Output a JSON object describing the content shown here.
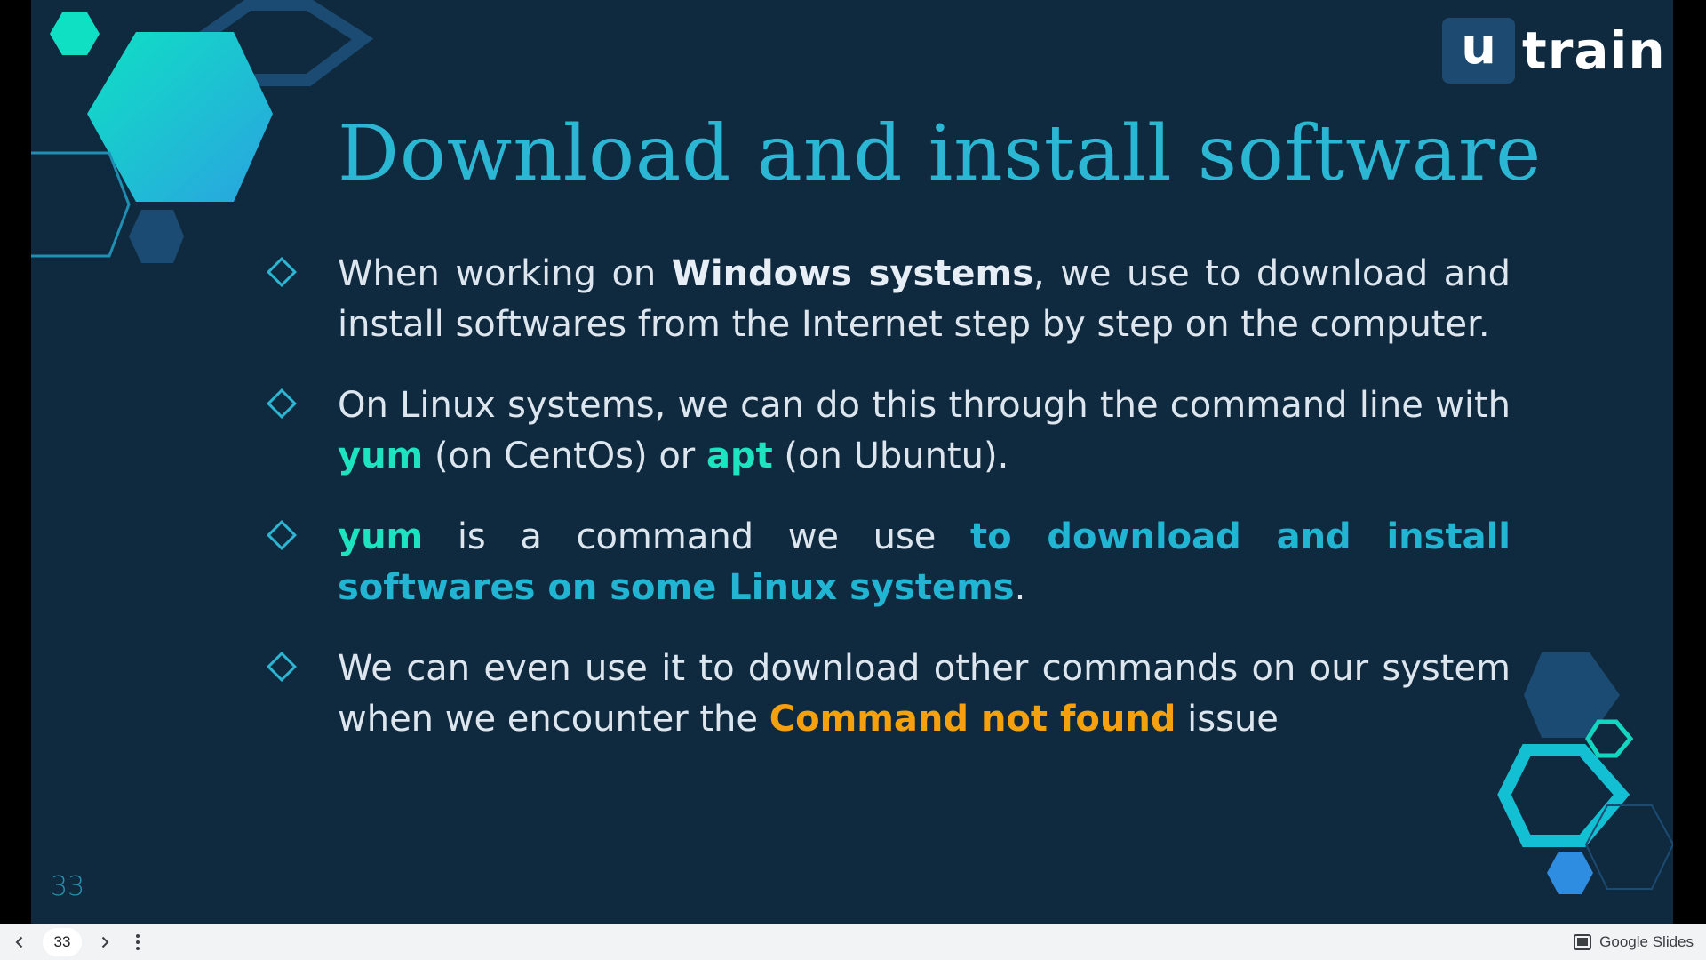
{
  "slide": {
    "title": "Download and install software",
    "slide_number": "33",
    "logo": {
      "u": "u",
      "word": "train"
    },
    "bullets": [
      {
        "segments": [
          {
            "text": "When working on ",
            "style": "normal"
          },
          {
            "text": "Windows systems",
            "style": "white"
          },
          {
            "text": ", we use to download and install softwares from the Internet step by step on the computer.",
            "style": "normal"
          }
        ]
      },
      {
        "segments": [
          {
            "text": "On Linux systems, we can do this through the command line with ",
            "style": "normal"
          },
          {
            "text": "yum",
            "style": "green"
          },
          {
            "text": " (on CentOs) or ",
            "style": "normal"
          },
          {
            "text": "apt",
            "style": "green"
          },
          {
            "text": " (on Ubuntu).",
            "style": "normal"
          }
        ]
      },
      {
        "segments": [
          {
            "text": "yum",
            "style": "green"
          },
          {
            "text": " is a command we use ",
            "style": "normal"
          },
          {
            "text": "to download and install softwares on some Linux systems",
            "style": "cyan"
          },
          {
            "text": ".",
            "style": "normal"
          }
        ]
      },
      {
        "segments": [
          {
            "text": "We can even use it to download other commands on our system when we encounter the ",
            "style": "normal"
          },
          {
            "text": "Command not found",
            "style": "orange"
          },
          {
            "text": " issue",
            "style": "normal"
          }
        ]
      }
    ]
  },
  "player": {
    "current_page": "33",
    "prev_icon": "chevron-left-icon",
    "next_icon": "chevron-right-icon",
    "more_icon": "more-vert-icon",
    "brand_icon": "slides-icon",
    "brand_label": "Google Slides"
  },
  "colors": {
    "background": "#0f2a3e",
    "title": "#2bb6d4",
    "accent_green": "#1ee3c0",
    "accent_cyan": "#22b5d3",
    "accent_orange": "#f5a00e"
  }
}
